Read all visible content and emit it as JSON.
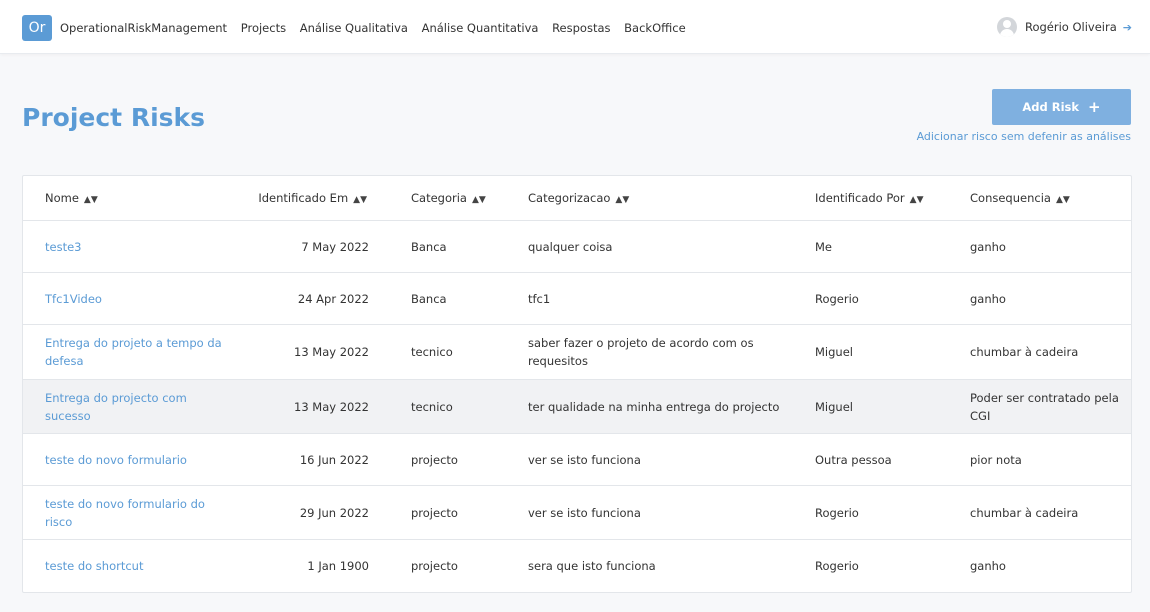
{
  "brand": {
    "logo": "Or",
    "name": "OperationalRiskManagement"
  },
  "nav": [
    "Projects",
    "Análise Qualitativa",
    "Análise Quantitativa",
    "Respostas",
    "BackOffice"
  ],
  "user": {
    "name": "Rogério Oliveira"
  },
  "page": {
    "title": "Project Risks",
    "add_button": "Add Risk",
    "add_link": "Adicionar risco sem defenir as análises"
  },
  "table": {
    "headers": [
      "Nome",
      "Identificado Em",
      "Categoria",
      "Categorizacao",
      "Identificado Por",
      "Consequencia"
    ],
    "rows": [
      [
        "teste3",
        "7 May 2022",
        "Banca",
        "qualquer coisa",
        "Me",
        "ganho"
      ],
      [
        "Tfc1Video",
        "24 Apr 2022",
        "Banca",
        "tfc1",
        "Rogerio",
        "ganho"
      ],
      [
        "Entrega do projeto a tempo da defesa",
        "13 May 2022",
        "tecnico",
        "saber fazer o projeto de acordo com os requesitos",
        "Miguel",
        "chumbar à cadeira"
      ],
      [
        "Entrega do projecto  com sucesso",
        "13 May 2022",
        "tecnico",
        "ter qualidade na minha entrega do projecto",
        "Miguel",
        "Poder ser contratado pela CGI"
      ],
      [
        "teste do novo formulario",
        "16 Jun 2022",
        "projecto",
        "ver se isto funciona",
        "Outra pessoa",
        "pior nota"
      ],
      [
        "teste do novo formulario do risco",
        "29 Jun 2022",
        "projecto",
        "ver se isto funciona",
        "Rogerio",
        "chumbar à cadeira"
      ],
      [
        "teste do shortcut",
        "1 Jan 1900",
        "projecto",
        "sera que isto funciona",
        "Rogerio",
        "ganho"
      ]
    ]
  },
  "colors": {
    "accent": "#5b9bd5",
    "button": "#7fb0e0",
    "highlight_row": "#f1f2f4"
  }
}
